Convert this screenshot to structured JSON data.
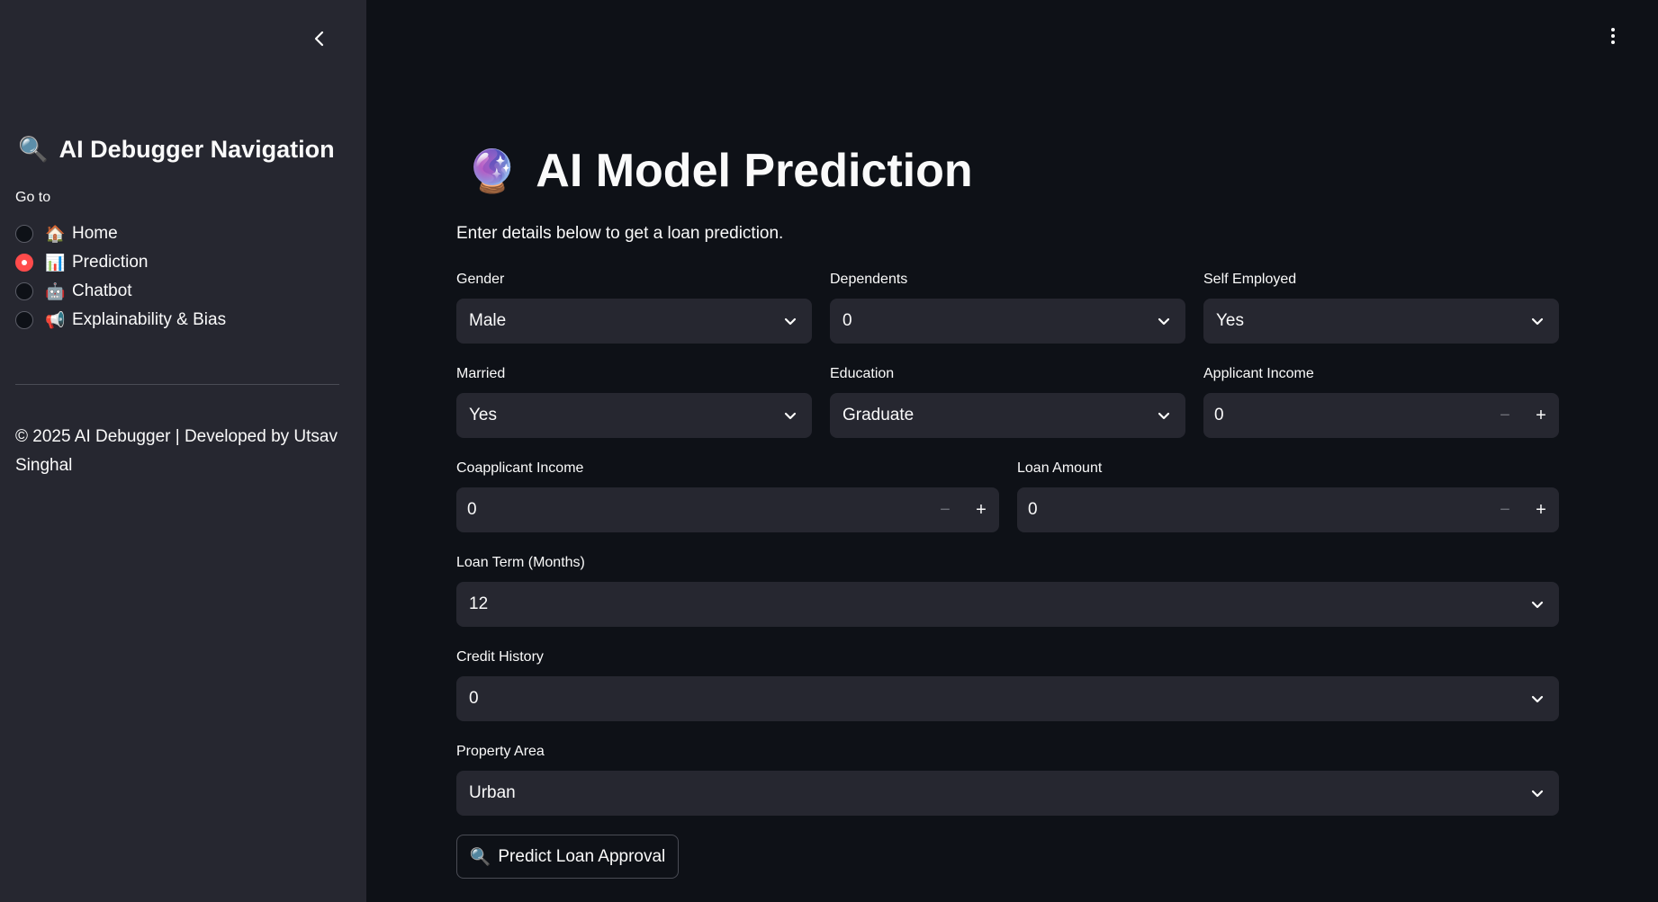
{
  "sidebar": {
    "title_emoji": "🔍",
    "title": "AI Debugger Navigation",
    "goto_label": "Go to",
    "nav": [
      {
        "emoji": "🏠",
        "label": "Home",
        "selected": false
      },
      {
        "emoji": "📊",
        "label": "Prediction",
        "selected": true
      },
      {
        "emoji": "🤖",
        "label": "Chatbot",
        "selected": false
      },
      {
        "emoji": "📢",
        "label": "Explainability & Bias",
        "selected": false
      }
    ],
    "footer": "© 2025 AI Debugger | Developed by Utsav Singhal"
  },
  "main": {
    "title_emoji": "🔮",
    "title": "AI Model Prediction",
    "subtitle": "Enter details below to get a loan prediction.",
    "fields": {
      "gender": {
        "label": "Gender",
        "value": "Male"
      },
      "dependents": {
        "label": "Dependents",
        "value": "0"
      },
      "self_employed": {
        "label": "Self Employed",
        "value": "Yes"
      },
      "married": {
        "label": "Married",
        "value": "Yes"
      },
      "education": {
        "label": "Education",
        "value": "Graduate"
      },
      "applicant_income": {
        "label": "Applicant Income",
        "value": "0"
      },
      "coapplicant_income": {
        "label": "Coapplicant Income",
        "value": "0"
      },
      "loan_amount": {
        "label": "Loan Amount",
        "value": "0"
      },
      "loan_term": {
        "label": "Loan Term (Months)",
        "value": "12"
      },
      "credit_history": {
        "label": "Credit History",
        "value": "0"
      },
      "property_area": {
        "label": "Property Area",
        "value": "Urban"
      }
    },
    "predict_emoji": "🔍",
    "predict_label": "Predict Loan Approval"
  },
  "colors": {
    "background": "#0e1117",
    "sidebar": "#262730",
    "input": "#262730",
    "accent": "#ff4b4b",
    "text": "#fafafa"
  }
}
